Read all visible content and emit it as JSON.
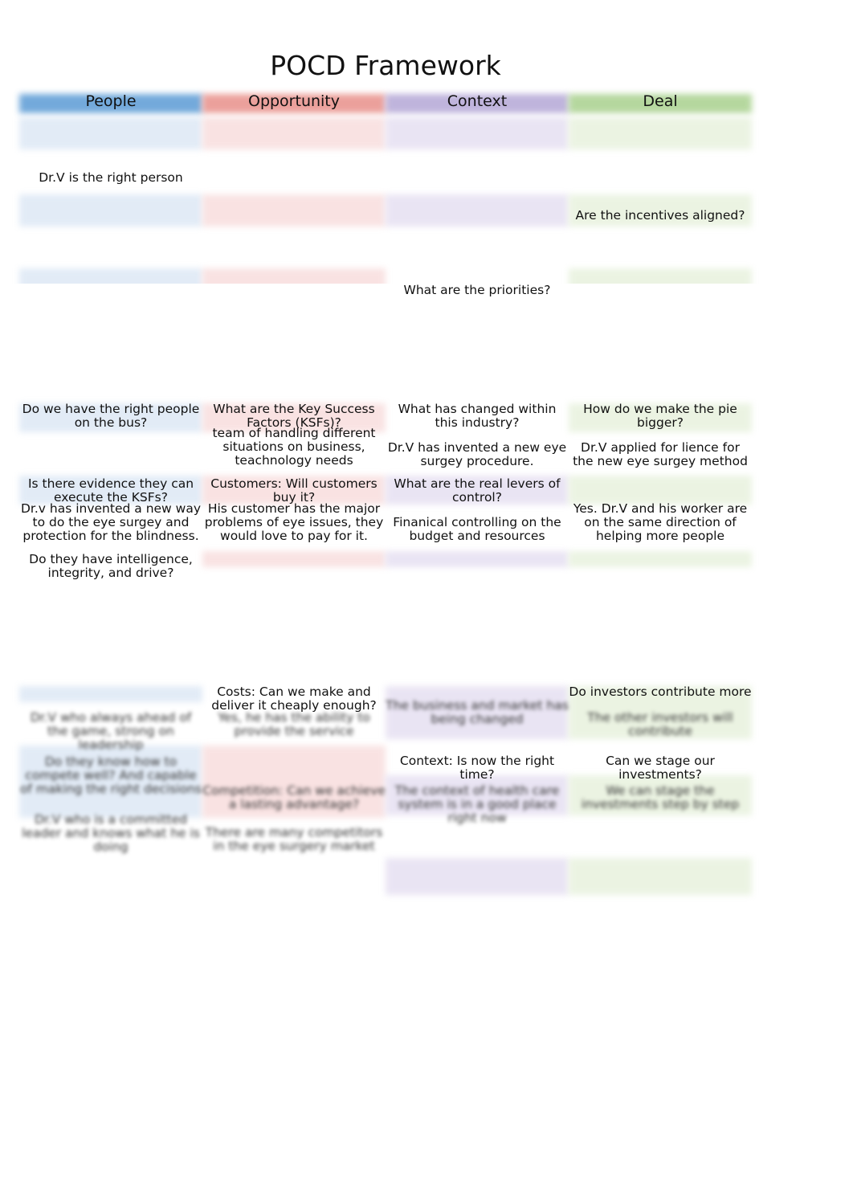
{
  "title": "POCD Framework",
  "colors": {
    "people": "#5b9bd5",
    "opportunity": "#e8908a",
    "context": "#b4a7d6",
    "deal": "#a9d18e",
    "people_light": "#dde8f5",
    "opportunity_light": "#f8dede",
    "context_light": "#e6e0f2",
    "deal_light": "#e8f2de"
  },
  "headers": [
    "People",
    "Opportunity",
    "Context",
    "Deal"
  ],
  "cells": {
    "people_top": "Dr.V is the right person",
    "deal_top": "Are the incentives aligned?",
    "context_priorities": "What are the priorities?",
    "people_q1": "Do we have the right people on the bus?",
    "opportunity_q1": "What are the Key Success Factors (KSFs)?",
    "opportunity_a1": "team of handling different situations on business, teachnology needs",
    "context_q1": "What has changed within this industry?",
    "context_a1": "Dr.V has invented a new eye surgey procedure.",
    "deal_q1": "How do we make the pie bigger?",
    "deal_a1": "Dr.V applied for lience for the new eye surgey method",
    "people_q2": "Is there evidence they can execute the KSFs?",
    "people_a2": "Dr.v has invented a new way to do the eye surgey and protection for the blindness.",
    "opportunity_q2": "Customers: Will customers buy it?",
    "opportunity_a2": "His customer has the major problems of eye issues, they would love to pay for it.",
    "context_q2": "What are the real levers of control?",
    "context_a2": "Finanical controlling on the budget and resources",
    "deal_a2": "Yes. Dr.V and his worker are on the same direction of helping more people",
    "people_q3": "Do they have intelligence, integrity, and drive?",
    "opportunity_q3": "Costs: Can we make and deliver it cheaply enough?",
    "deal_q3": "Do investors contribute more",
    "context_q4": "Context: Is now the right time?",
    "deal_q4": "Can we stage our investments?",
    "blurred_people_1": "Dr.V who always ahead of the game, strong on leadership",
    "blurred_opportunity_1": "Yes, he has the ability to provide the service",
    "blurred_context_1": "The business and market has being changed",
    "blurred_deal_1": "The other investors will contribute",
    "blurred_people_2": "Do they know how to compete well? And capable of making the right decisions",
    "blurred_people_3": "Dr.V who is a committed leader and knows what he is doing",
    "blurred_opportunity_2": "Competition: Can we achieve a lasting advantage?",
    "blurred_opportunity_3": "There are many competitors in the eye surgery market",
    "blurred_context_2": "The context of health care system is in a good place right now",
    "blurred_deal_2": "We can stage the investments step by step"
  }
}
